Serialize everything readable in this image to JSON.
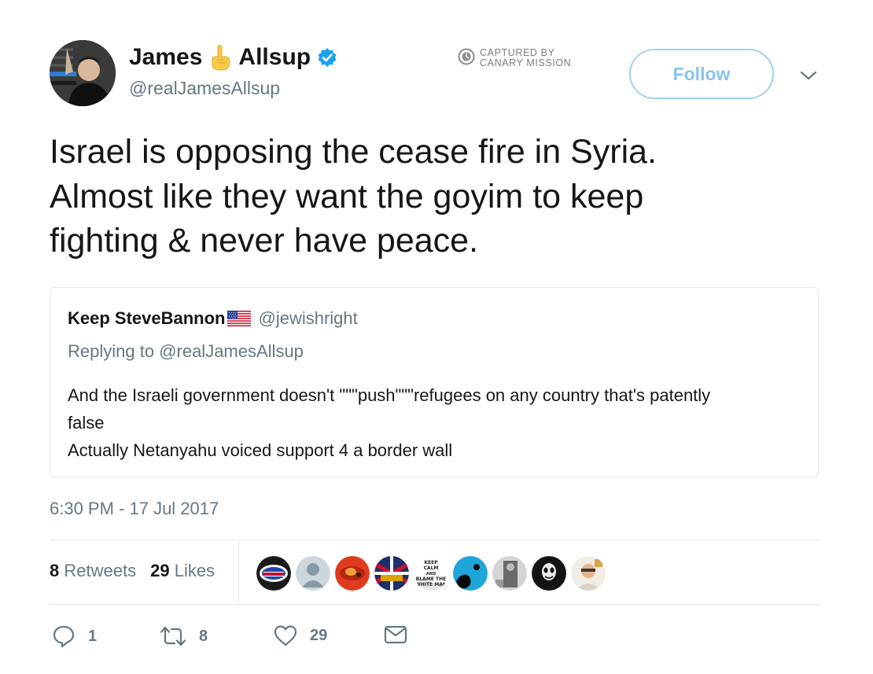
{
  "author": {
    "display_name_first": "James",
    "display_name_last": "Allsup",
    "name_emoji": "pointing-finger-emoji",
    "handle": "@realJamesAllsup",
    "verified": true
  },
  "watermark": {
    "line1": "CAPTURED BY",
    "line2": "CANARY MISSION"
  },
  "follow_label": "Follow",
  "tweet_text": [
    "Israel is opposing the cease fire in Syria.",
    "Almost like they want the goyim to keep",
    "fighting & never have peace."
  ],
  "quoted": {
    "name": "Keep SteveBannon",
    "name_flag": "us-flag-icon",
    "handle": "@jewishright",
    "replying_to": "Replying to @realJamesAllsup",
    "body": [
      "And the Israeli government doesn't \"\"\"push\"\"\"refugees on any country that's patently",
      "false",
      "Actually Netanyahu voiced support 4 a border wall"
    ]
  },
  "timestamp": "6:30 PM - 17 Jul 2017",
  "stats": {
    "retweets_count": "8",
    "retweets_label": "Retweets",
    "likes_count": "29",
    "likes_label": "Likes"
  },
  "liker_avatars": [
    "voted-sticker-avatar",
    "default-avatar",
    "red-avatar",
    "flag-avatar",
    "keep-calm-avatar",
    "blue-avatar",
    "gray-avatar",
    "dark-avatar",
    "light-avatar"
  ],
  "liker_avatar_texts": {
    "keep_calm": [
      "KEEP",
      "CALM",
      "AND",
      "BLAME THE",
      "WHITE MAN"
    ]
  },
  "actions": {
    "reply_count": "1",
    "retweet_count": "8",
    "like_count": "29"
  },
  "colors": {
    "text": "#14171a",
    "secondary": "#657786",
    "follow_border": "#9fd0f2",
    "follow_text": "#88c3ec",
    "verified": "#1da1f2",
    "divider": "#e1e8ed"
  }
}
